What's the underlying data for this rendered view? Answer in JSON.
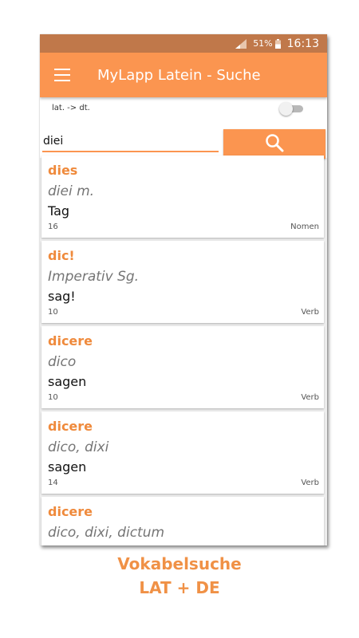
{
  "status_bar": {
    "battery_percent": "51%",
    "time": "16:13",
    "icons": [
      "signal-icon",
      "battery-icon"
    ]
  },
  "app_bar": {
    "title": "MyLapp Latein - Suche",
    "menu_icon": "menu-icon"
  },
  "controls": {
    "direction_label": "lat. -> dt.",
    "toggle_on": false,
    "search_value": "diei",
    "search_button_icon": "search-icon"
  },
  "results": [
    {
      "lemma": "dies",
      "forms": "diei m.",
      "meaning": "Tag",
      "count": "16",
      "type": "Nomen"
    },
    {
      "lemma": "dic!",
      "forms": "Imperativ Sg.",
      "meaning": "sag!",
      "count": "10",
      "type": "Verb"
    },
    {
      "lemma": "dicere",
      "forms": "dico",
      "meaning": "sagen",
      "count": "10",
      "type": "Verb"
    },
    {
      "lemma": "dicere",
      "forms": "dico, dixi",
      "meaning": "sagen",
      "count": "14",
      "type": "Verb"
    },
    {
      "lemma": "dicere",
      "forms": "dico, dixi, dictum",
      "meaning": "",
      "count": "",
      "type": ""
    }
  ],
  "caption": {
    "line1": "Vokabelsuche",
    "line2": "LAT + DE"
  },
  "colors": {
    "status_bar": "#c0784a",
    "accent": "#fb9550",
    "lemma": "#ef8a3c",
    "caption": "#f09146",
    "background": "#eeeeee"
  }
}
